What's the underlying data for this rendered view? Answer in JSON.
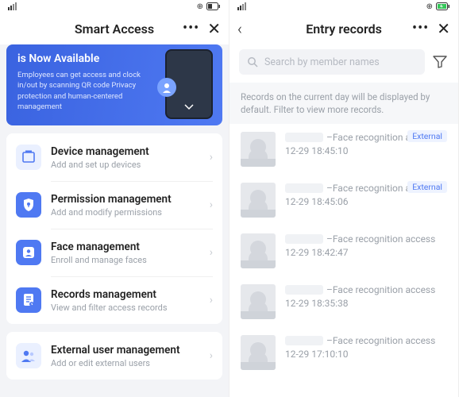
{
  "left": {
    "title": "Smart Access",
    "banner": {
      "title": "is Now Available",
      "desc": "Employees can get access and clock in/out by scanning QR code Privacy protection and human-centered management"
    },
    "menu": [
      {
        "icon": "device",
        "title": "Device management",
        "sub": "Add and set up devices"
      },
      {
        "icon": "permission",
        "title": "Permission management",
        "sub": "Add and modify permissions"
      },
      {
        "icon": "face",
        "title": "Face management",
        "sub": "Enroll and manage faces"
      },
      {
        "icon": "records",
        "title": "Records management",
        "sub": "View and filter access records"
      }
    ],
    "ext": {
      "title": "External user management",
      "sub": "Add or edit external users"
    }
  },
  "right": {
    "title": "Entry records",
    "search_placeholder": "Search by member names",
    "hint": "Records on the current day will be displayed by default. Filter to view more records.",
    "access_label": "–Face recognition access",
    "external_label": "External",
    "records": [
      {
        "time": "12-29 18:45:10",
        "external": true
      },
      {
        "time": "12-29 18:45:06",
        "external": true
      },
      {
        "time": "12-29 18:42:47",
        "external": false
      },
      {
        "time": "12-29 18:35:38",
        "external": false
      },
      {
        "time": "12-29 17:10:10",
        "external": false
      }
    ]
  }
}
